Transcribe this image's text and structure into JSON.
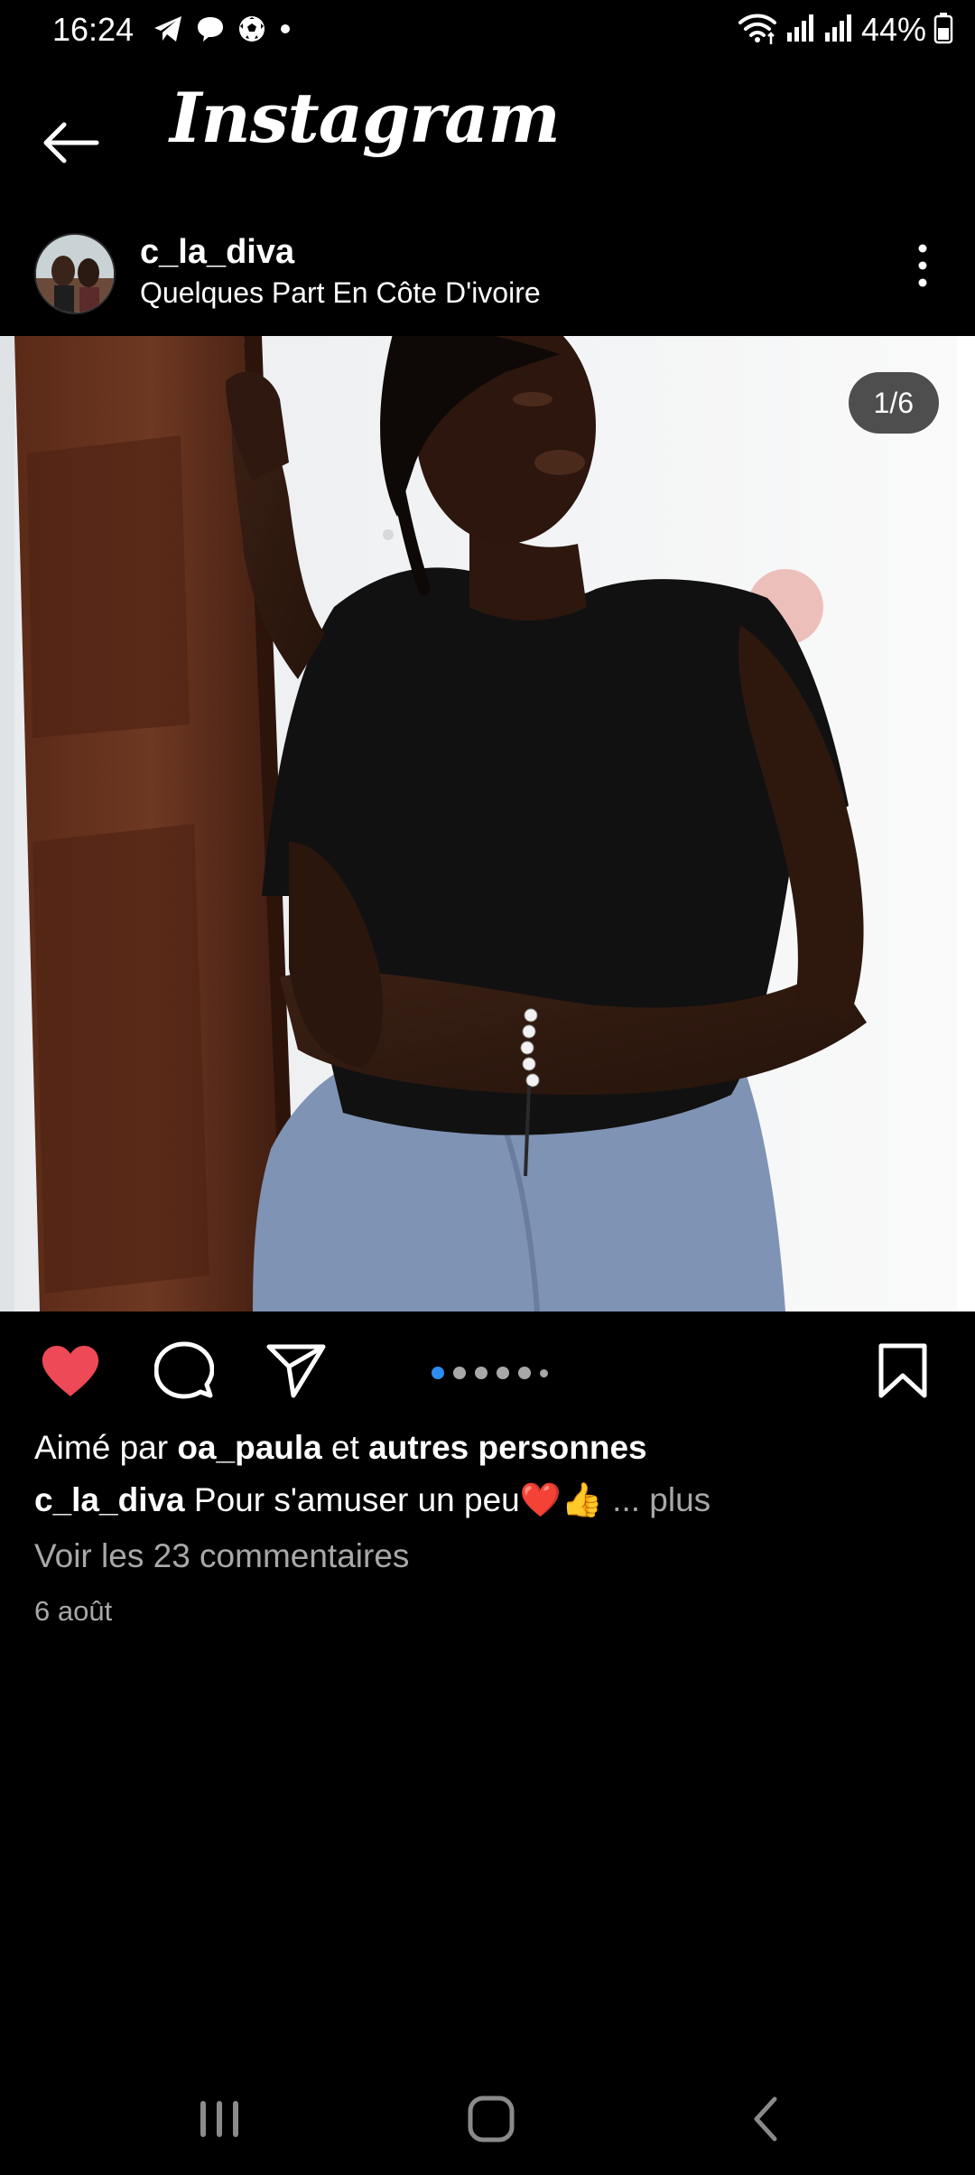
{
  "status_bar": {
    "time": "16:24",
    "left_icons": [
      "telegram-icon",
      "chat-bubble-icon",
      "soccer-ball-icon",
      "notification-dot-icon"
    ],
    "right_icons": [
      "wifi-icon",
      "signal-icon",
      "signal-icon",
      "battery-icon"
    ],
    "battery": "44%"
  },
  "header": {
    "app_title": "Instagram",
    "back_icon": "arrow-left-icon"
  },
  "post": {
    "author": "c_la_diva",
    "location": "Quelques Part En Côte D'ivoire",
    "image_counter": "1/6",
    "image_total": 6,
    "current_image": 1,
    "liked": true,
    "likes": {
      "prefix": "Aimé par ",
      "user": "oa_paula",
      "middle": " et ",
      "others": "autres personnes"
    },
    "caption": {
      "author": "c_la_diva",
      "text": " Pour s'amuser un peu❤️👍",
      "more": " ... plus"
    },
    "comments_link": "Voir les 23 commentaires",
    "date": "6 août"
  },
  "colors": {
    "background": "#000000",
    "like_red": "#ed4956",
    "dot_active": "#2d8cf0",
    "muted_text": "#a8a8a8"
  }
}
